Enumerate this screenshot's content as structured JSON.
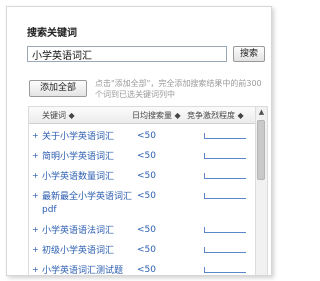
{
  "panel": {
    "title": "搜索关键词",
    "search_value": "小学英语词汇",
    "search_button": "搜索",
    "add_all_button": "添加全部",
    "hint": "点击\"添加全部\"，完全添加搜索结果中的前300个词到已选关键词列中"
  },
  "table": {
    "headers": {
      "keyword": "关键词 ◆",
      "volume": "日均搜索量 ◆",
      "trend": "竞争激烈程度 ◆"
    },
    "rows": [
      {
        "plus": "+",
        "keyword": "关于小学英语词汇",
        "volume": "<50"
      },
      {
        "plus": "+",
        "keyword": "简明小学英语词汇",
        "volume": "<50"
      },
      {
        "plus": "+",
        "keyword": "小学英语数量词汇",
        "volume": "<50"
      },
      {
        "plus": "+",
        "keyword": "最新最全小学英语词汇pdf",
        "volume": "<50"
      },
      {
        "plus": "+",
        "keyword": "小学英语语法词汇",
        "volume": "<50"
      },
      {
        "plus": "+",
        "keyword": "初级小学英语词汇",
        "volume": "<50"
      },
      {
        "plus": "+",
        "keyword": "小学英语词汇测试题",
        "volume": "<50"
      }
    ]
  },
  "colors": {
    "link": "#2a5db0",
    "hint": "#9a9a9a",
    "border": "#9aa8b8"
  }
}
